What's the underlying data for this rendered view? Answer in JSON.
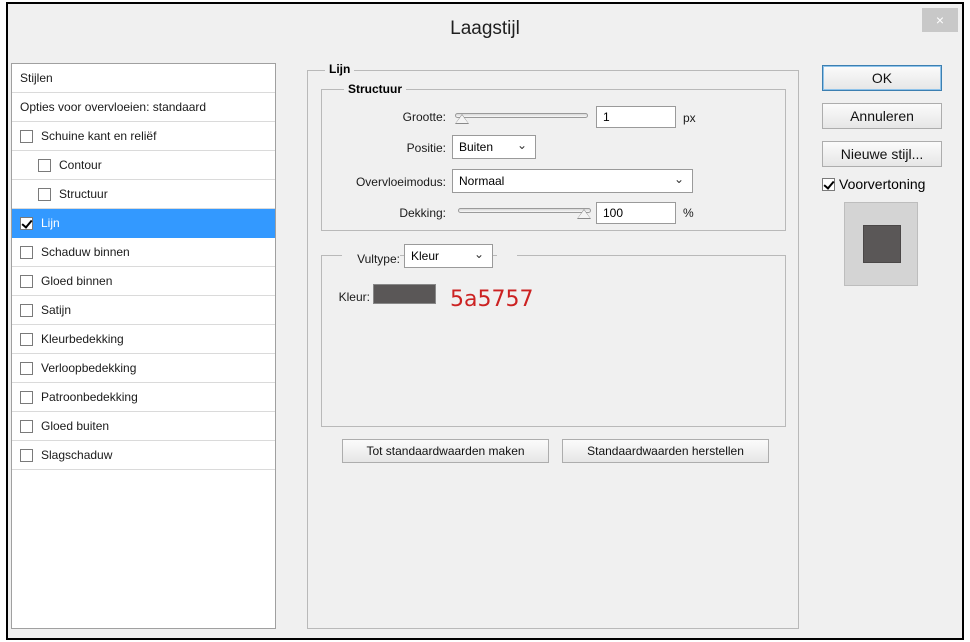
{
  "window": {
    "title": "Laagstijl",
    "close_symbol": "×"
  },
  "styles_list": {
    "header": "Stijlen",
    "blend_options": "Opties voor overvloeien: standaard",
    "items": [
      {
        "label": "Schuine kant en reliëf",
        "checked": false,
        "indent": false
      },
      {
        "label": "Contour",
        "checked": false,
        "indent": true
      },
      {
        "label": "Structuur",
        "checked": false,
        "indent": true
      },
      {
        "label": "Lijn",
        "checked": true,
        "indent": false,
        "selected": true
      },
      {
        "label": "Schaduw binnen",
        "checked": false,
        "indent": false
      },
      {
        "label": "Gloed binnen",
        "checked": false,
        "indent": false
      },
      {
        "label": "Satijn",
        "checked": false,
        "indent": false
      },
      {
        "label": "Kleurbedekking",
        "checked": false,
        "indent": false
      },
      {
        "label": "Verloopbedekking",
        "checked": false,
        "indent": false
      },
      {
        "label": "Patroonbedekking",
        "checked": false,
        "indent": false
      },
      {
        "label": "Gloed buiten",
        "checked": false,
        "indent": false
      },
      {
        "label": "Slagschaduw",
        "checked": false,
        "indent": false
      }
    ]
  },
  "stroke": {
    "section_title": "Lijn",
    "structure_title": "Structuur",
    "size": {
      "label": "Grootte:",
      "value": "1",
      "unit": "px",
      "slider_fraction": 0.0
    },
    "position": {
      "label": "Positie:",
      "value": "Buiten"
    },
    "blend_mode": {
      "label": "Overvloeimodus:",
      "value": "Normaal"
    },
    "opacity": {
      "label": "Dekking:",
      "value": "100",
      "unit": "%",
      "slider_fraction": 1.0
    },
    "fill_type": {
      "label": "Vultype:",
      "value": "Kleur"
    },
    "color": {
      "label": "Kleur:",
      "hex": "#5a5757",
      "annotation": "5a5757"
    },
    "make_default_label": "Tot standaardwaarden maken",
    "reset_default_label": "Standaardwaarden herstellen"
  },
  "actions": {
    "ok_label": "OK",
    "cancel_label": "Annuleren",
    "new_style_label": "Nieuwe stijl...",
    "preview_label": "Voorvertoning",
    "preview_checked": true
  }
}
